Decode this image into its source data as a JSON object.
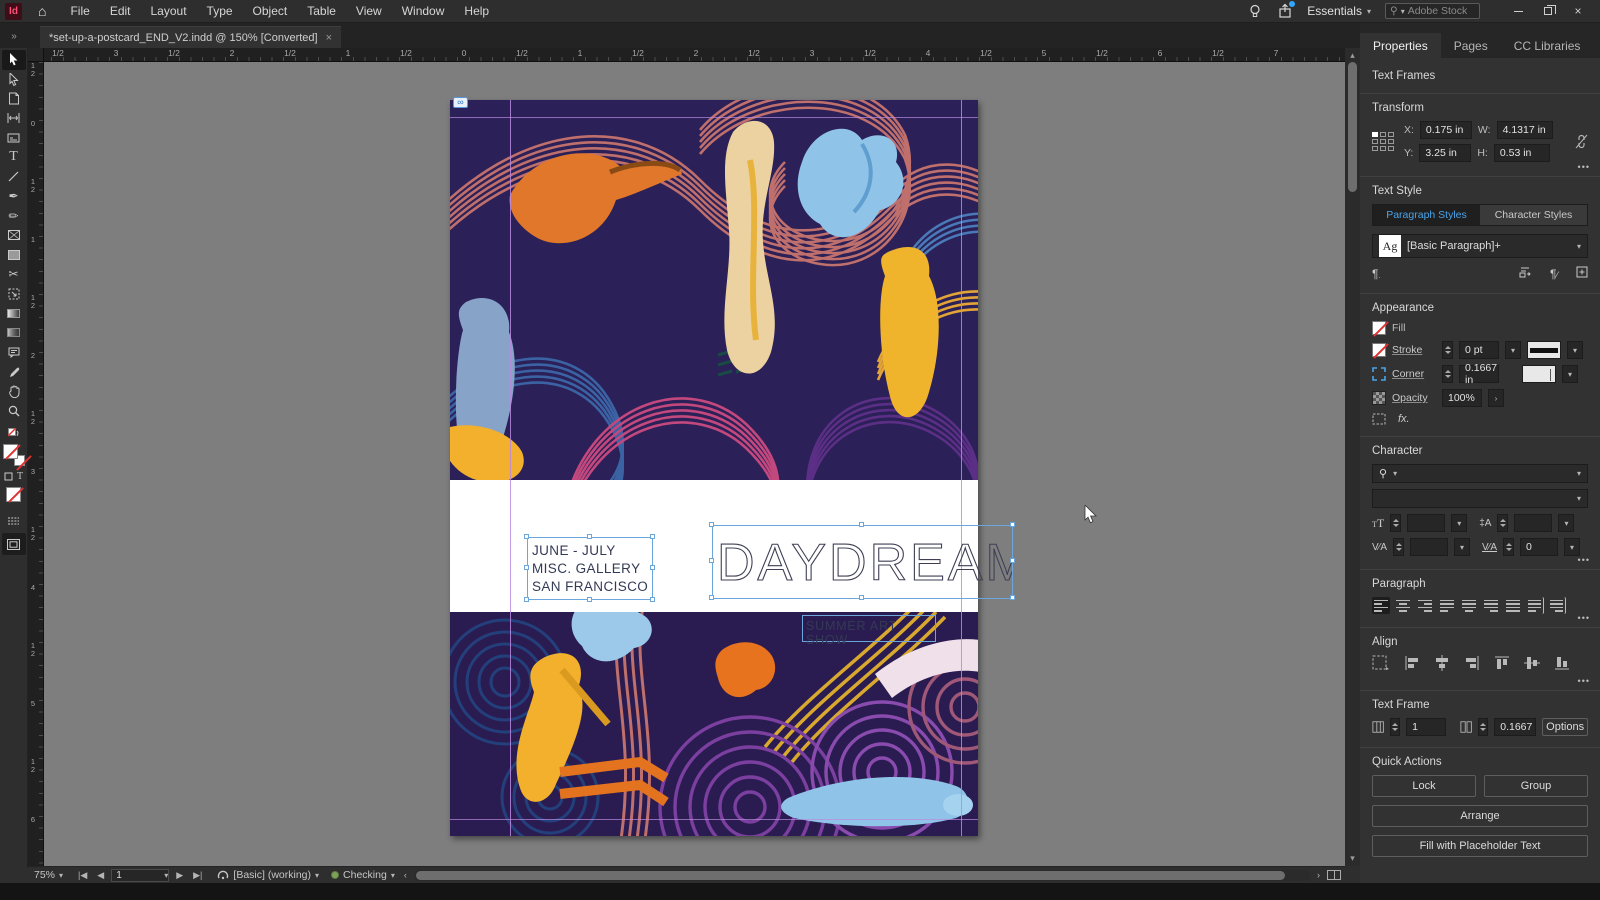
{
  "ui": {
    "more": "•••",
    "flyout": "»",
    "close": "×"
  },
  "appbar": {
    "logo": "Id",
    "menus": [
      "File",
      "Edit",
      "Layout",
      "Type",
      "Object",
      "Table",
      "View",
      "Window",
      "Help"
    ],
    "workspace": "Essentials",
    "search_placeholder": "Adobe Stock"
  },
  "tab": {
    "title": "*set-up-a-postcard_END_V2.indd @ 150% [Converted]"
  },
  "rulers": {
    "horizontal": [
      "1/2",
      "3",
      "1/2",
      "2",
      "1/2",
      "1",
      "1/2",
      "0",
      "1/2",
      "1",
      "1/2",
      "2",
      "1/2",
      "3",
      "1/2",
      "4",
      "1/2",
      "5",
      "1/2",
      "6",
      "1/2",
      "7"
    ],
    "vertical": [
      "1/2",
      "0",
      "1/2",
      "1",
      "1/2",
      "2",
      "1/2",
      "3",
      "1/2",
      "4",
      "1/2",
      "5",
      "1/2",
      "6"
    ]
  },
  "canvas": {
    "dates_frame_lines": [
      "JUNE - JULY",
      "MISC. GALLERY",
      "SAN FRANCISCO"
    ],
    "title": "DAYDREAM",
    "subtitle": "SUMMER ART SHOW"
  },
  "statusbar": {
    "zoom": "75%",
    "page": "1",
    "preset": "[Basic] (working)",
    "preflight": "Checking"
  },
  "panel": {
    "tabs": [
      "Properties",
      "Pages",
      "CC Libraries"
    ],
    "context_header": "Text Frames",
    "transform": {
      "title": "Transform",
      "x_label": "X:",
      "x": "0.175 in",
      "y_label": "Y:",
      "y": "3.25 in",
      "w_label": "W:",
      "w": "4.1317 in",
      "h_label": "H:",
      "h": "0.53 in"
    },
    "text_style": {
      "title": "Text Style",
      "tab_paragraph": "Paragraph Styles",
      "tab_character": "Character Styles",
      "sample": "Ag",
      "style_name": "[Basic Paragraph]+"
    },
    "appearance": {
      "title": "Appearance",
      "fill": "Fill",
      "stroke": "Stroke",
      "stroke_weight": "0 pt",
      "corner": "Corner",
      "corner_radius": "0.1667 in",
      "opacity": "Opacity",
      "opacity_value": "100%",
      "fx": "fx."
    },
    "character": {
      "title": "Character",
      "tracking": "0"
    },
    "paragraph": {
      "title": "Paragraph"
    },
    "align": {
      "title": "Align"
    },
    "text_frame": {
      "title": "Text Frame",
      "columns": "1",
      "inset": "0.1667",
      "options": "Options"
    },
    "quick_actions": {
      "title": "Quick Actions",
      "lock": "Lock",
      "group": "Group",
      "arrange": "Arrange",
      "fill_placeholder": "Fill with Placeholder Text"
    }
  },
  "colors": {
    "accent_blue": "#4aa3e8",
    "selection_blue": "#6ba7dc",
    "guide_violet": "#ba8ae0",
    "art_bg_top": "#2b2057",
    "art_bg_bottom": "#2a1c50",
    "art_rose": "#bf6f6c",
    "art_purple": "#7b3fa0",
    "art_magenta": "#c2487e",
    "art_yellow": "#f2b02c",
    "art_orange": "#e0772a",
    "art_blue": "#8fc3e8",
    "art_navy_swirl": "#23407c"
  }
}
